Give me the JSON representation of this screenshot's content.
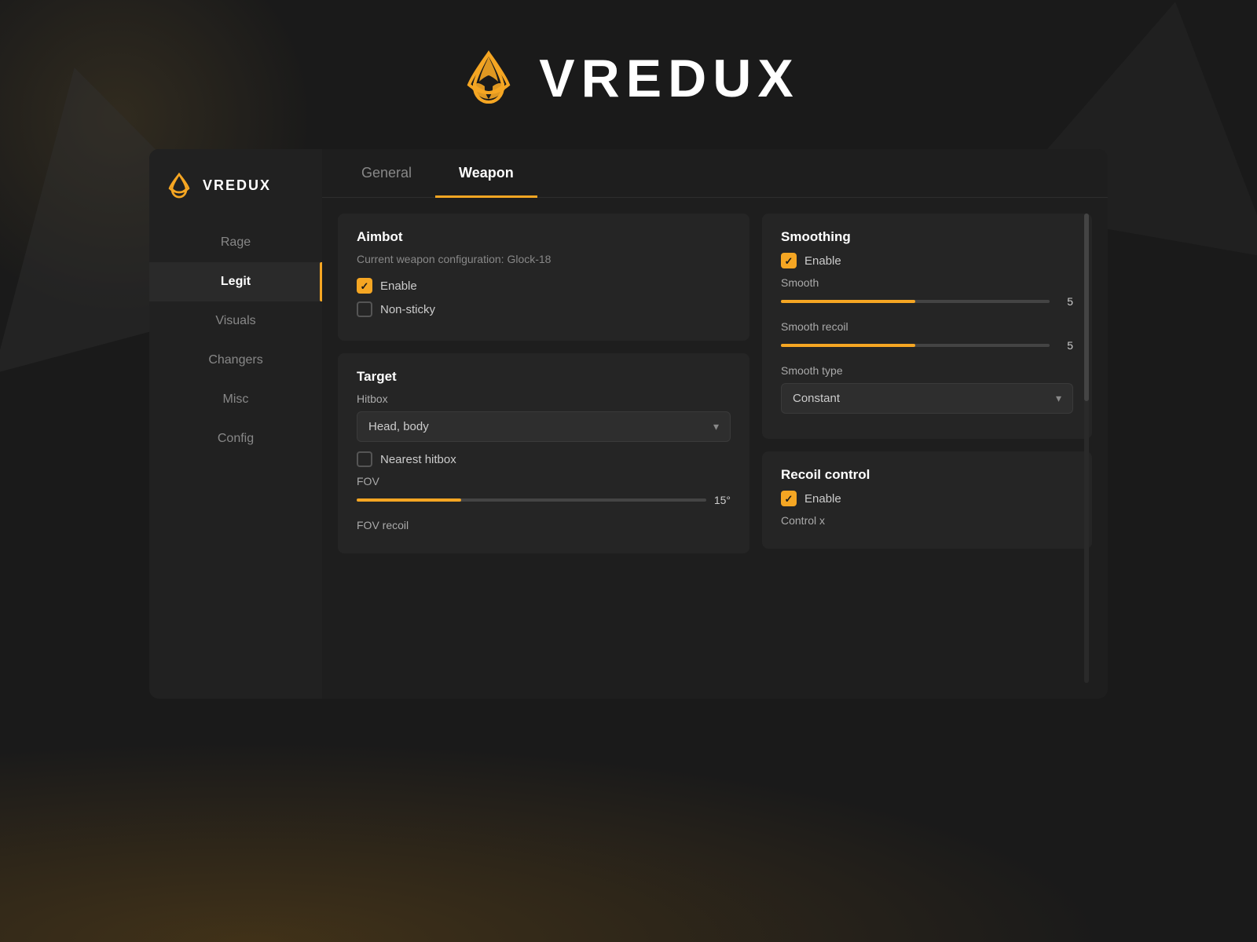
{
  "app": {
    "title": "VREDUX",
    "logo_alt": "vredux-logo"
  },
  "header": {
    "title": "VREDUX"
  },
  "sidebar": {
    "brand_name": "VREDUX",
    "nav_items": [
      {
        "id": "rage",
        "label": "Rage",
        "active": false
      },
      {
        "id": "legit",
        "label": "Legit",
        "active": true
      },
      {
        "id": "visuals",
        "label": "Visuals",
        "active": false
      },
      {
        "id": "changers",
        "label": "Changers",
        "active": false
      },
      {
        "id": "misc",
        "label": "Misc",
        "active": false
      },
      {
        "id": "config",
        "label": "Config",
        "active": false
      }
    ]
  },
  "tabs": [
    {
      "id": "general",
      "label": "General",
      "active": false
    },
    {
      "id": "weapon",
      "label": "Weapon",
      "active": true
    }
  ],
  "aimbot_card": {
    "title": "Aimbot",
    "subtitle": "Current weapon configuration: Glock-18",
    "enable_label": "Enable",
    "enable_checked": true,
    "nonsticky_label": "Non-sticky",
    "nonsticky_checked": false
  },
  "target_card": {
    "title": "Target",
    "hitbox_label": "Hitbox",
    "hitbox_value": "Head, body",
    "nearest_hitbox_label": "Nearest hitbox",
    "nearest_hitbox_checked": false,
    "fov_label": "FOV",
    "fov_value": "15°",
    "fov_percent": 30,
    "fov_recoil_label": "FOV recoil"
  },
  "smoothing_card": {
    "title": "Smoothing",
    "enable_label": "Enable",
    "enable_checked": true,
    "smooth_label": "Smooth",
    "smooth_value": "5",
    "smooth_percent": 50,
    "smooth_recoil_label": "Smooth recoil",
    "smooth_recoil_value": "5",
    "smooth_recoil_percent": 50,
    "smooth_type_label": "Smooth type",
    "smooth_type_value": "Constant"
  },
  "recoil_card": {
    "title": "Recoil control",
    "enable_label": "Enable",
    "enable_checked": true,
    "control_x_label": "Control x"
  }
}
